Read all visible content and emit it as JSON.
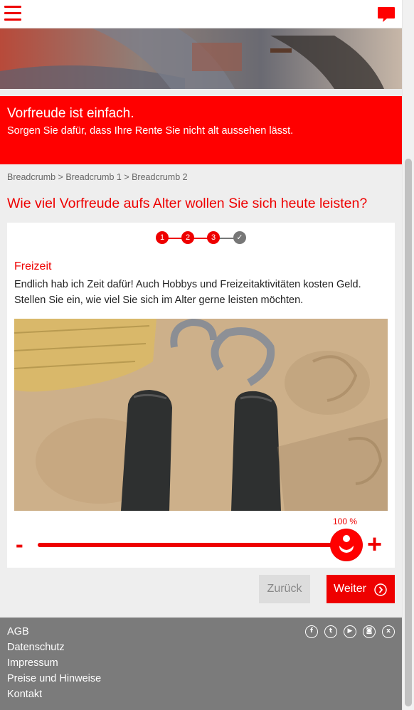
{
  "header": {
    "menu_icon": "hamburger-menu-icon",
    "chat_icon": "chat-bubble-icon",
    "accent_color": "#ff0000"
  },
  "banner": {
    "title": "Vorfreude ist einfach.",
    "subtitle": "Sorgen Sie dafür, dass Ihre Rente Sie nicht alt aussehen lässt."
  },
  "breadcrumb": "Breadcrumb > Breadcrumb 1 > Breadcrumb 2",
  "question": "Wie viel Vorfreude aufs Alter wollen Sie sich heute leisten?",
  "steps": {
    "items": [
      "1",
      "2",
      "3"
    ],
    "done_mark": "✓"
  },
  "section": {
    "title": "Freizeit",
    "text": "Endlich hab ich Zeit dafür! Auch Hobbys und Freizeitaktivitäten kosten Geld. Stellen Sie ein, wie viel Sie sich im Alter gerne leisten möchten."
  },
  "slider": {
    "value_label": "100 %",
    "value_percent": 100,
    "minus_label": "-",
    "plus_label": "+"
  },
  "buttons": {
    "back": "Zurück",
    "next": "Weiter"
  },
  "footer": {
    "links": [
      "AGB",
      "Datenschutz",
      "Impressum",
      "Preise und Hinweise",
      "Kontakt"
    ],
    "social": [
      {
        "name": "facebook-icon",
        "glyph": "f"
      },
      {
        "name": "twitter-icon",
        "glyph": "t"
      },
      {
        "name": "youtube-icon",
        "glyph": "▶"
      },
      {
        "name": "instagram-icon",
        "glyph": "◙"
      },
      {
        "name": "xing-icon",
        "glyph": "x"
      }
    ]
  }
}
